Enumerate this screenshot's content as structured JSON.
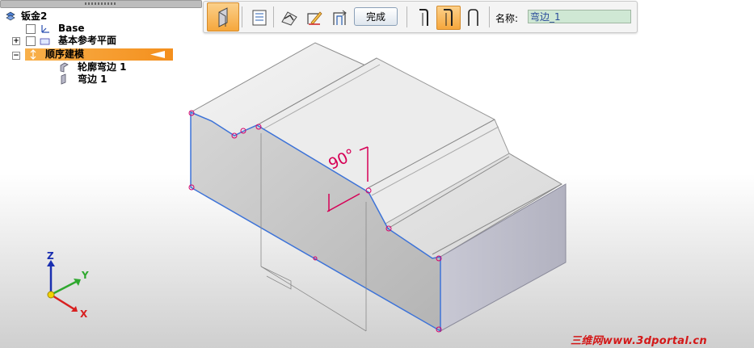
{
  "tree": {
    "root": {
      "label": "钣金2",
      "icon": "sheet-metal-part-icon"
    },
    "items": [
      {
        "label": "Base",
        "icon": "coordinate-system-icon",
        "expander": ""
      },
      {
        "label": "基本参考平面",
        "icon": "reference-planes-icon",
        "expander": "+"
      },
      {
        "label": "顺序建模",
        "icon": "sequential-modeling-icon",
        "expander": "−"
      },
      {
        "label": "轮廓弯边 1",
        "icon": "contour-flange-icon"
      },
      {
        "label": "弯边 1",
        "icon": "flange-icon"
      }
    ]
  },
  "toolbar": {
    "finish_label": "完成",
    "name_label": "名称:",
    "name_value": "弯边_1"
  },
  "annotation": {
    "angle": "90°"
  },
  "triad": {
    "z": "Z",
    "y": "Y",
    "x": "X"
  },
  "watermark": "三维网www.3dportal.cn",
  "colors": {
    "highlight": "#f6a73c",
    "edge_highlight": "#3d73d8",
    "dimension": "#d60056",
    "watermark": "#d31818"
  }
}
